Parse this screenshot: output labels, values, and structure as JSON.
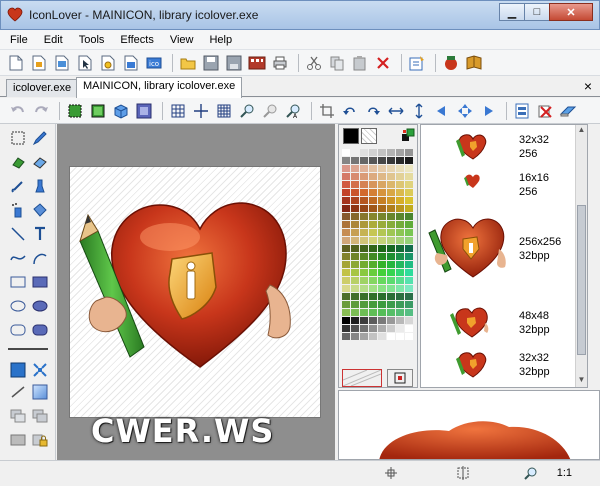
{
  "window": {
    "title": "IconLover - MAINICON, library icolover.exe",
    "minimize_icon": "minimize-icon",
    "maximize_icon": "maximize-icon",
    "close_icon": "close-icon"
  },
  "menu": {
    "items": [
      {
        "label": "File"
      },
      {
        "label": "Edit"
      },
      {
        "label": "Tools"
      },
      {
        "label": "Effects"
      },
      {
        "label": "View"
      },
      {
        "label": "Help"
      }
    ]
  },
  "tabs": {
    "items": [
      {
        "label": "icolover.exe",
        "active": false
      },
      {
        "label": "MAINICON, library icolover.exe",
        "active": true
      }
    ],
    "close_label": "×"
  },
  "watermark": {
    "text": "CWER.WS"
  },
  "formats": {
    "items": [
      {
        "size": "32x32",
        "depth": "256"
      },
      {
        "size": "16x16",
        "depth": "256"
      },
      {
        "size": "256x256",
        "depth": "32bpp"
      },
      {
        "size": "48x48",
        "depth": "32bpp"
      },
      {
        "size": "32x32",
        "depth": "32bpp"
      }
    ]
  },
  "status": {
    "zoom": "1:1"
  },
  "colors": {
    "heart": "#c8361b",
    "heart_dark": "#8e1b08",
    "pencil": "#3f9b2f",
    "shield": "#f1a12c",
    "accent": "#2a72c9"
  }
}
